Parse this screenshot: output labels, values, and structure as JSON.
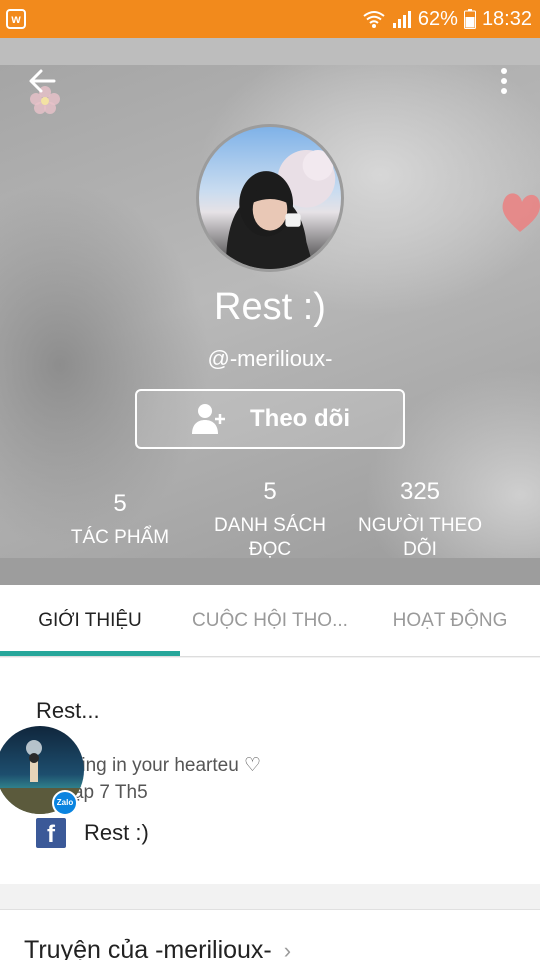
{
  "status_bar": {
    "app_icon": "wattpad-icon",
    "battery_percent": "62%",
    "time": "18:32",
    "color": "#f28a1c"
  },
  "header": {
    "back_icon": "back-arrow-icon",
    "more_icon": "more-vertical-icon"
  },
  "profile": {
    "display_name": "Rest :)",
    "username": "@-merilioux-",
    "follow_label": "Theo dõi",
    "follow_icon": "add-person-icon"
  },
  "stats": [
    {
      "value": "5",
      "label": "TÁC PHẨM"
    },
    {
      "value": "5",
      "label": "DANH SÁCH ĐỌC"
    },
    {
      "value": "325",
      "label": "NGƯỜI THEO DÕI"
    }
  ],
  "tabs": [
    {
      "label": "GIỚI THIỆU",
      "active": true
    },
    {
      "label": "CUỘC HỘI THO...",
      "active": false
    },
    {
      "label": "HOẠT ĐỘNG",
      "active": false
    }
  ],
  "accent_color": "#26a69a",
  "about": {
    "title": "Rest...",
    "bio": "m sitting in your hearteu ♡",
    "joined": "a nhập 7 Th5",
    "facebook_label": "Rest :)"
  },
  "chat_head": {
    "badge": "Zalo"
  },
  "stories": {
    "title": "Truyện của -merilioux-",
    "chevron": "›"
  }
}
